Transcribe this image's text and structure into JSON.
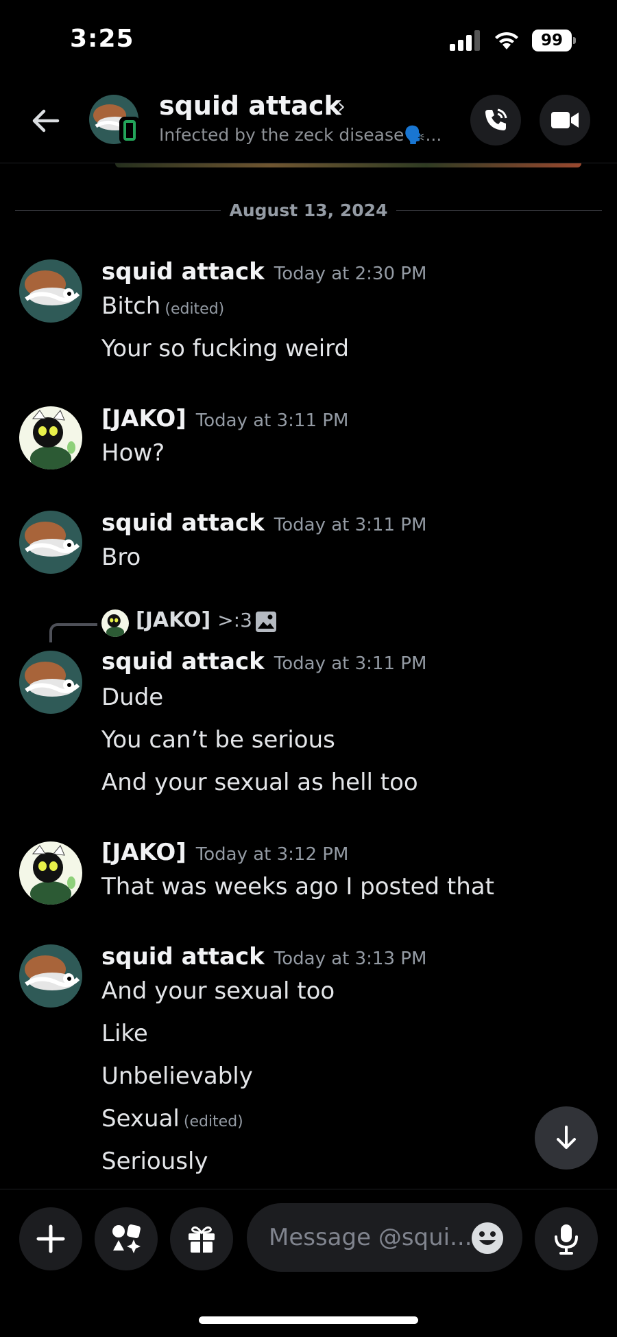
{
  "status_bar": {
    "time": "3:25",
    "battery": "99"
  },
  "header": {
    "title": "squid attack",
    "chevron": "›",
    "subtitle": "Infected by the zeck disease🗣️..."
  },
  "date_divider": "August 13, 2024",
  "messages": [
    {
      "author": "squid attack",
      "time": "Today at 2:30 PM",
      "lines": [
        "Bitch",
        "Your so fucking weird"
      ],
      "edited": "(edited)"
    },
    {
      "author": "[JAKO]",
      "time": "Today at 3:11 PM",
      "lines": [
        "How?"
      ]
    },
    {
      "author": "squid attack",
      "time": "Today at 3:11 PM",
      "lines": [
        "Bro"
      ]
    },
    {
      "reply_to": {
        "author": "[JAKO]",
        "text": ">:3"
      },
      "author": "squid attack",
      "time": "Today at 3:11 PM",
      "lines": [
        "Dude",
        "You can’t be serious",
        "And your sexual as hell too"
      ]
    },
    {
      "author": "[JAKO]",
      "time": "Today at 3:12 PM",
      "lines": [
        "That was weeks ago I posted that"
      ]
    },
    {
      "author": "squid attack",
      "time": "Today at 3:13 PM",
      "lines": [
        "And your sexual too",
        "Like",
        "Unbelievably",
        "Sexual",
        "Seriously"
      ],
      "edited": "(edited)"
    }
  ],
  "composer": {
    "placeholder": "Message @squi..."
  },
  "icons": {
    "back": "arrow-left-icon",
    "call": "phone-call-icon",
    "video": "video-camera-icon",
    "plus": "plus-icon",
    "apps": "apps-icon",
    "gift": "gift-icon",
    "emoji": "emoji-icon",
    "mic": "microphone-icon",
    "scroll": "arrow-down-icon"
  },
  "colors": {
    "background": "#000000",
    "online": "#23a55a",
    "muted_text": "#949ba4"
  }
}
